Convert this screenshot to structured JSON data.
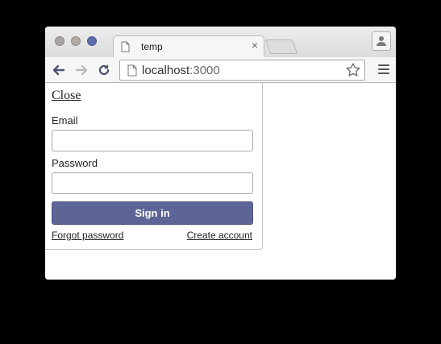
{
  "browser": {
    "tab_title": "temp",
    "tab_close": "×",
    "url_host": "localhost",
    "url_port": ":3000"
  },
  "icons": {
    "back": "arrow-left-icon",
    "forward": "arrow-right-icon",
    "reload": "reload-icon",
    "page": "document-icon",
    "bookmark": "star-icon",
    "menu": "hamburger-menu-icon",
    "profile": "profile-icon"
  },
  "colors": {
    "accent": "#5d6597",
    "traffic_close": "#a9a4a4",
    "traffic_min": "#b3a9a3",
    "traffic_max": "#5e6cae"
  },
  "login": {
    "close_label": "Close",
    "email_label": "Email",
    "email_value": "",
    "password_label": "Password",
    "password_value": "",
    "signin_label": "Sign in",
    "forgot_label": "Forgot password",
    "create_label": "Create account"
  }
}
